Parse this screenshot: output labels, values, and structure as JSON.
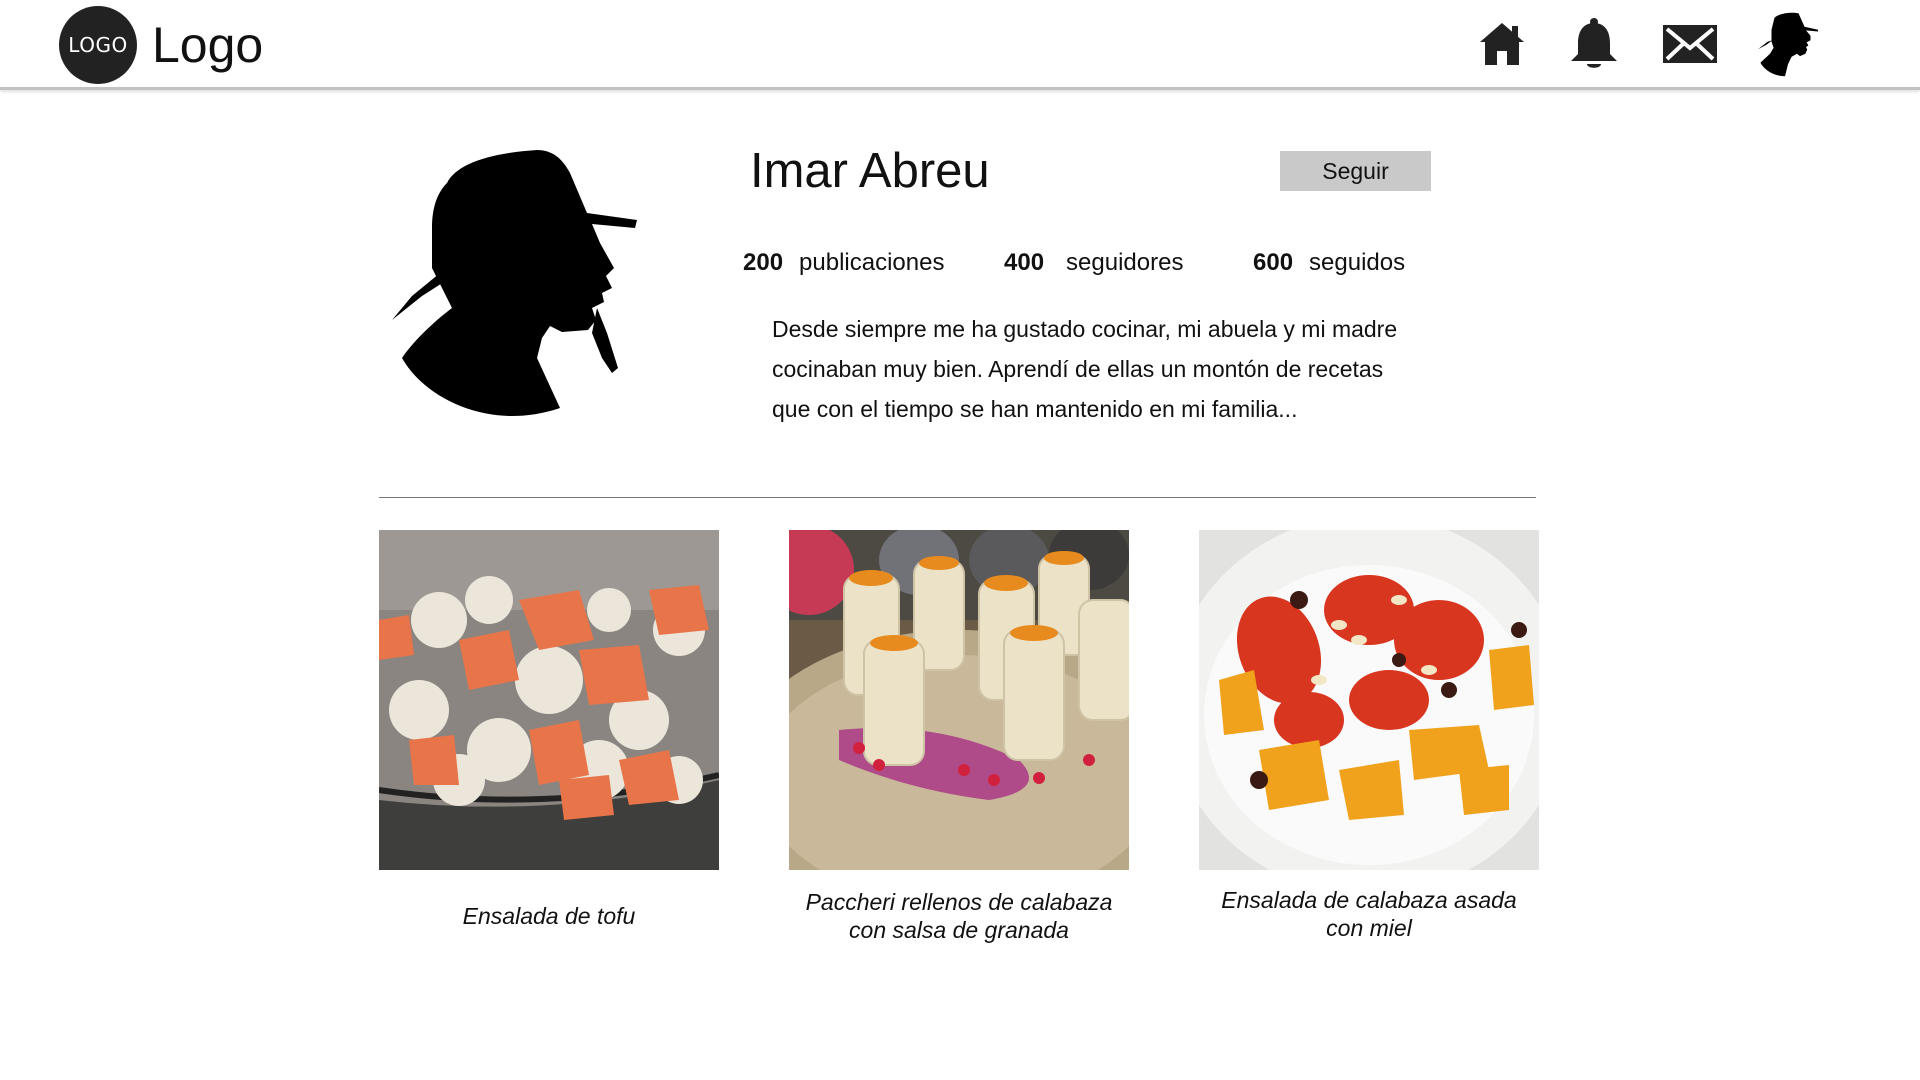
{
  "header": {
    "logo_badge": "LOGO",
    "logo_text": "Logo",
    "nav": [
      {
        "icon": "home-icon"
      },
      {
        "icon": "bell-icon"
      },
      {
        "icon": "mail-icon"
      },
      {
        "icon": "user-avatar-icon"
      }
    ]
  },
  "profile": {
    "name": "Imar Abreu",
    "follow_label": "Seguir",
    "stats": [
      {
        "count": "200",
        "label": "publicaciones"
      },
      {
        "count": "400",
        "label": "seguidores"
      },
      {
        "count": "600",
        "label": "seguidos"
      }
    ],
    "bio": "Desde siempre me ha gustado cocinar, mi abuela y mi madre cocinaban muy bien. Aprendí de ellas un montón de recetas que con el tiempo se han mantenido en mi familia..."
  },
  "posts": [
    {
      "caption_line1": "Ensalada de tofu",
      "caption_line2": ""
    },
    {
      "caption_line1": "Paccheri rellenos de calabaza",
      "caption_line2": "con salsa de granada"
    },
    {
      "caption_line1": "Ensalada de calabaza asada",
      "caption_line2": "con miel"
    }
  ],
  "colors": {
    "header_border": "#c2c2c2",
    "follow_button": "#c9c9c9",
    "logo_circle": "#222222"
  }
}
